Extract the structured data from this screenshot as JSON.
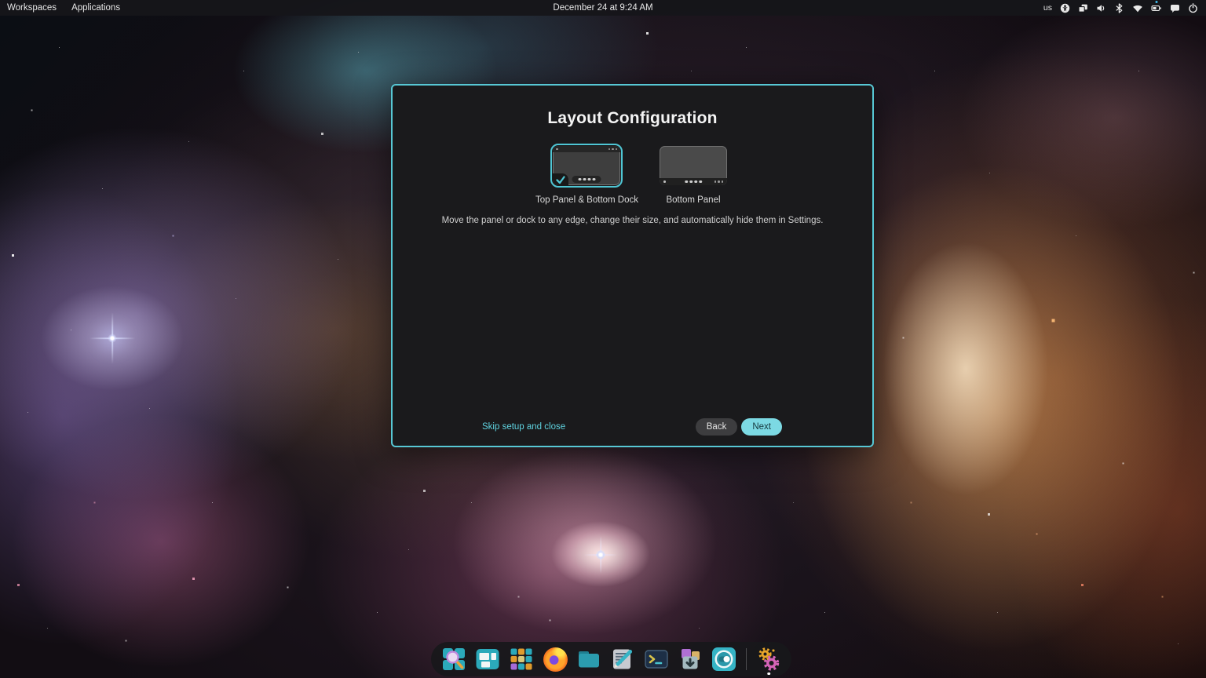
{
  "top_panel": {
    "menus": [
      {
        "label": "Workspaces"
      },
      {
        "label": "Applications"
      }
    ],
    "clock": "December 24 at 9:24 AM",
    "keyboard_layout": "us",
    "tray_icons": [
      "accessibility-icon",
      "displays-icon",
      "volume-icon",
      "bluetooth-icon",
      "wifi-icon",
      "battery-icon",
      "chat-icon",
      "power-icon"
    ]
  },
  "dialog": {
    "title": "Layout Configuration",
    "options": [
      {
        "label": "Top Panel & Bottom Dock",
        "selected": true
      },
      {
        "label": "Bottom Panel",
        "selected": false
      }
    ],
    "description": "Move the panel or dock to any edge, change their size, and automatically hide them in Settings.",
    "skip_link_label": "Skip setup and close",
    "back_button_label": "Back",
    "next_button_label": "Next"
  },
  "dock": {
    "items": [
      {
        "icon": "search-overview-icon"
      },
      {
        "icon": "workspaces-icon"
      },
      {
        "icon": "app-grid-icon"
      },
      {
        "icon": "firefox-icon"
      },
      {
        "icon": "files-icon"
      },
      {
        "icon": "text-editor-icon"
      },
      {
        "icon": "terminal-icon"
      },
      {
        "icon": "software-installer-icon"
      },
      {
        "icon": "settings-toggles-icon"
      },
      {
        "icon": "settings-gears-icon",
        "running": true
      }
    ]
  },
  "colors": {
    "accent": "#57c7d4",
    "next_button_bg": "#7cd9e3",
    "link": "#5fd2df",
    "battery_charge_dot": "#3db8e8"
  }
}
